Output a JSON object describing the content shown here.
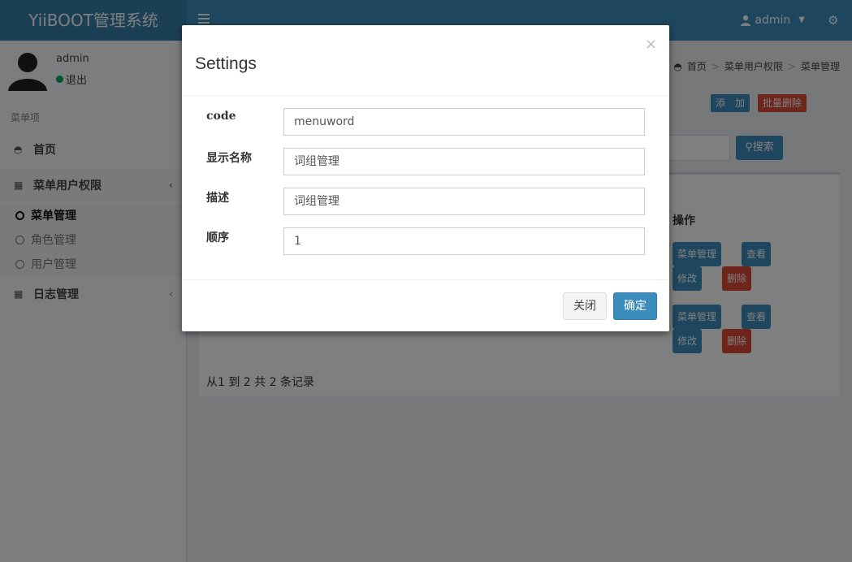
{
  "app": {
    "logo": "YiiBOOT管理系统"
  },
  "header": {
    "user": "admin"
  },
  "sidebar": {
    "user_name": "admin",
    "user_status": "退出",
    "menu_header": "菜单项",
    "items": [
      {
        "label": "首页",
        "icon": "dashboard-icon"
      },
      {
        "label": "菜单用户权限",
        "icon": "table-icon"
      },
      {
        "label": "日志管理",
        "icon": "table-icon"
      }
    ],
    "sub_items": [
      {
        "label": "菜单管理"
      },
      {
        "label": "角色管理"
      },
      {
        "label": "用户管理"
      }
    ]
  },
  "breadcrumb": [
    "首页",
    "菜单用户权限",
    "菜单管理"
  ],
  "toolbar": {
    "add": "添　加",
    "batch_delete": "批量删除",
    "search": "搜索"
  },
  "table": {
    "header_action": "操作",
    "row_buttons": {
      "menu": "菜单管理",
      "view": "查看",
      "edit": "修改",
      "delete": "删除"
    }
  },
  "pager": "从1 到 2 共 2 条记录",
  "modal": {
    "title": "Settings",
    "close_symbol": "×",
    "fields": [
      {
        "label": "code",
        "value": "menuword"
      },
      {
        "label": "显示名称",
        "value": "词组管理"
      },
      {
        "label": "描述",
        "value": "词组管理"
      },
      {
        "label": "顺序",
        "value": "1"
      }
    ],
    "close_button": "关闭",
    "ok_button": "确定"
  }
}
